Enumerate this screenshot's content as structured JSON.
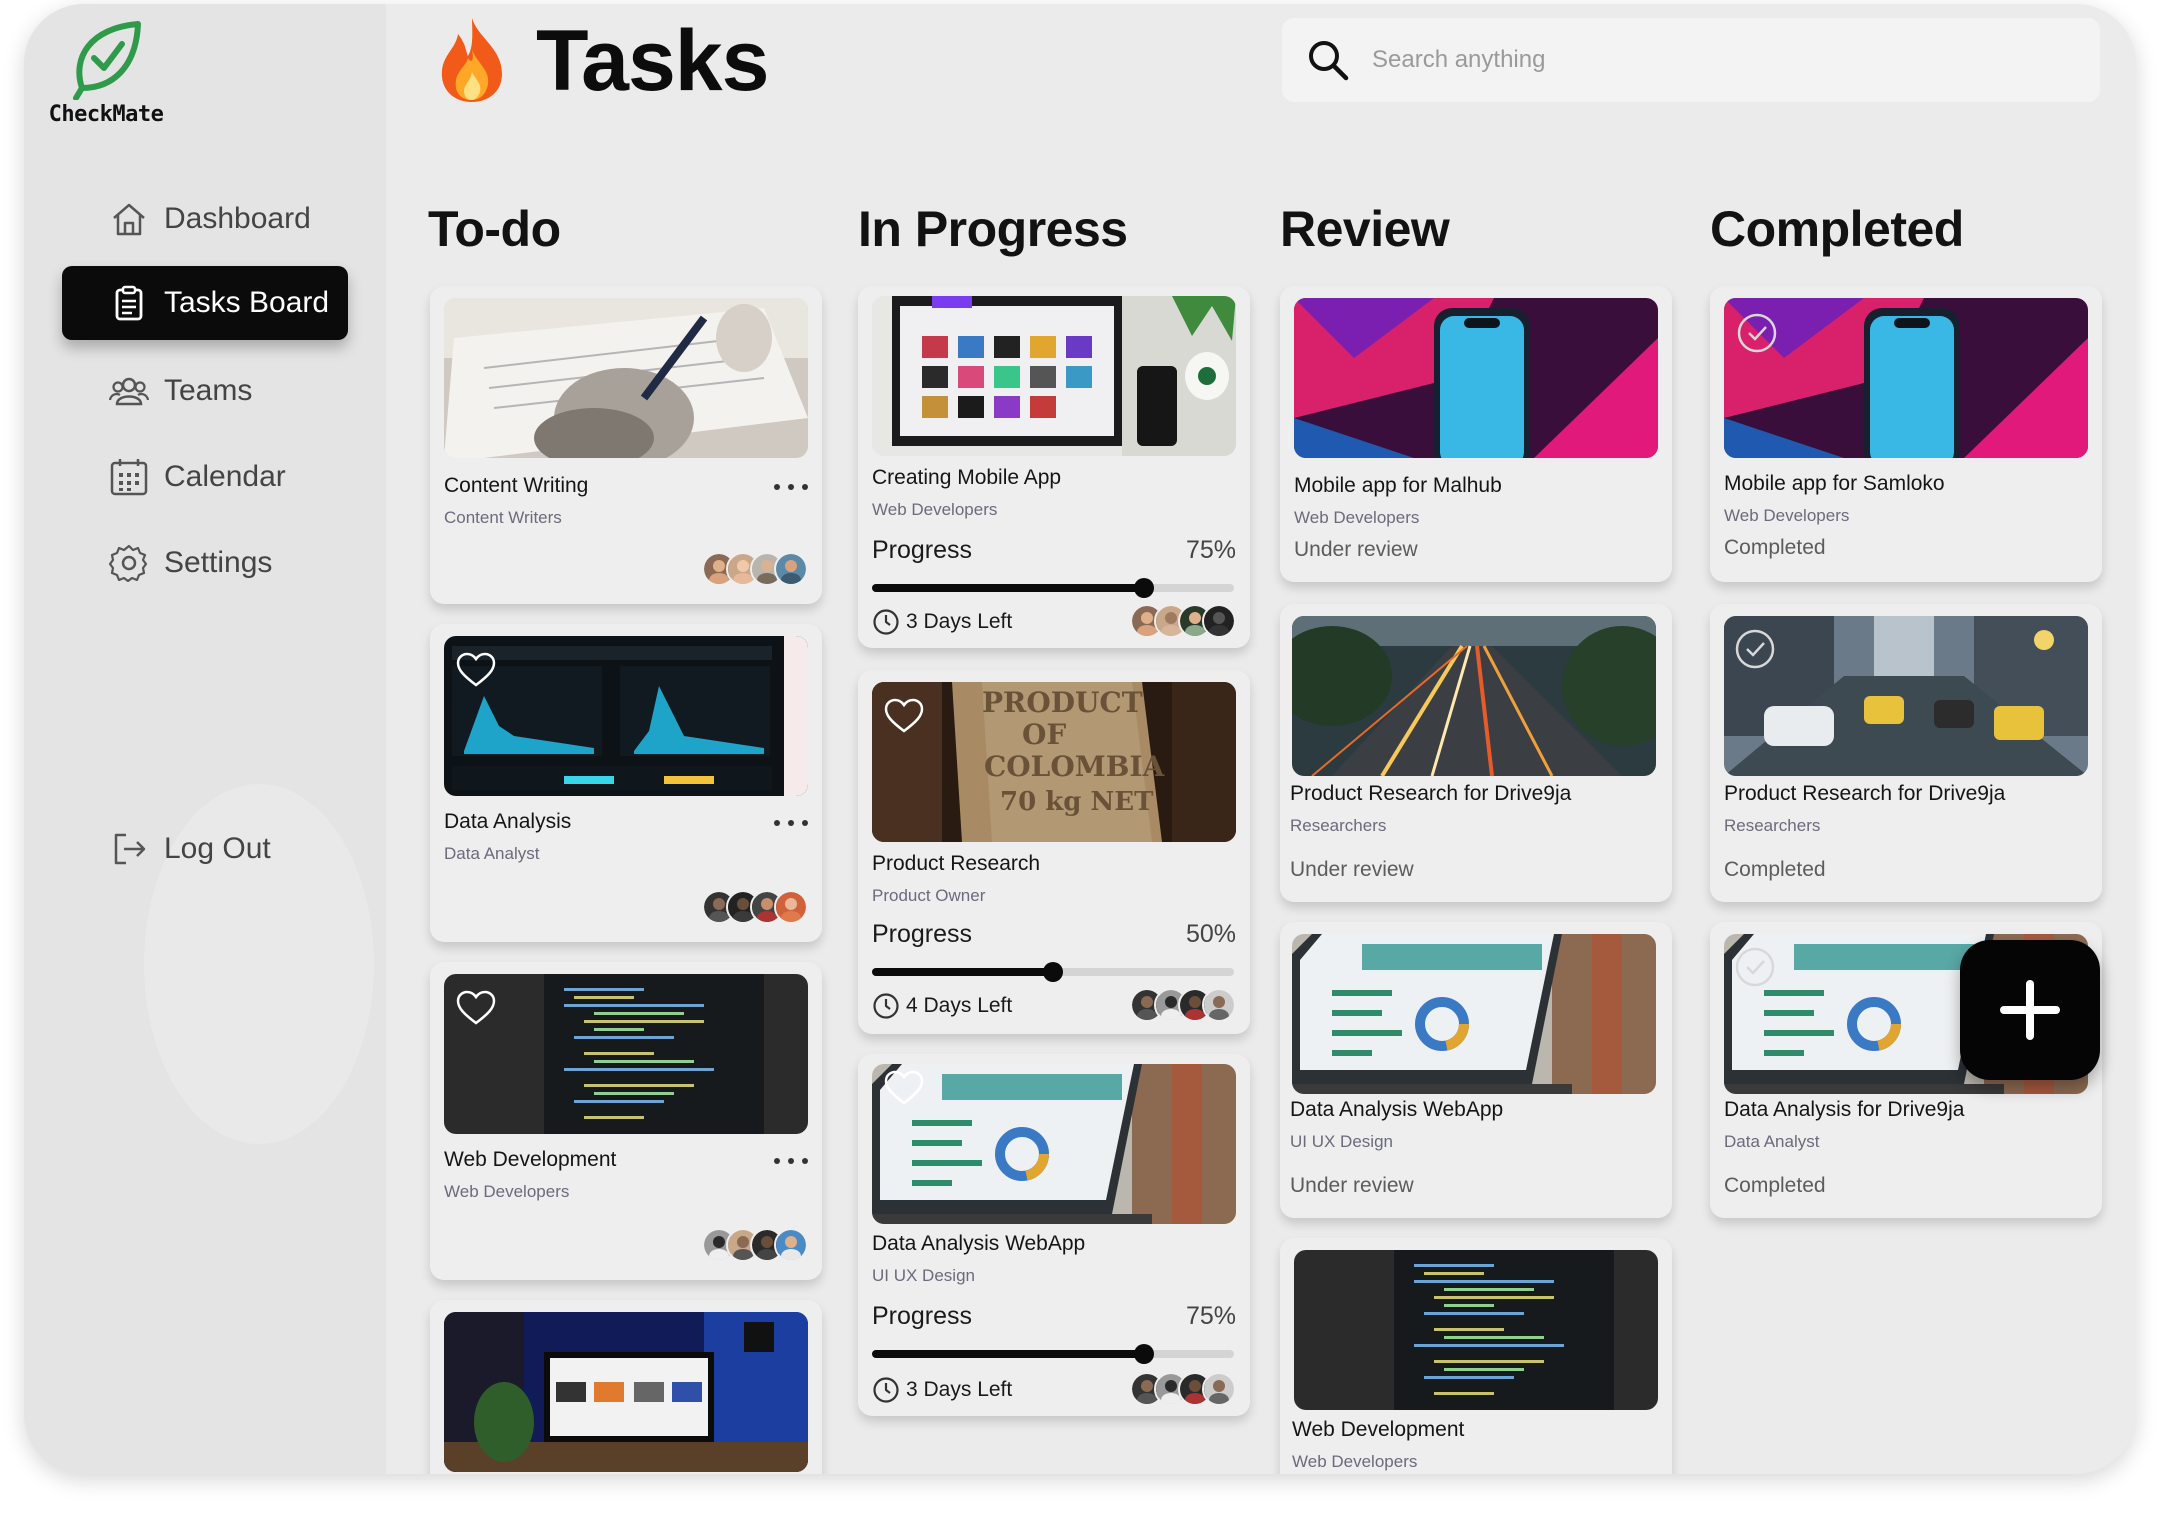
{
  "app": {
    "name": "CheckMate"
  },
  "sidebar": {
    "items": [
      {
        "label": "Dashboard",
        "icon": "home-icon"
      },
      {
        "label": "Tasks Board",
        "icon": "clipboard-icon",
        "active": true
      },
      {
        "label": "Teams",
        "icon": "users-icon"
      },
      {
        "label": "Calendar",
        "icon": "calendar-icon"
      },
      {
        "label": "Settings",
        "icon": "gear-icon"
      }
    ],
    "logout": {
      "label": "Log Out",
      "icon": "logout-icon"
    }
  },
  "header": {
    "emoji": "fire-icon",
    "title": "Tasks"
  },
  "search": {
    "placeholder": "Search anything",
    "value": ""
  },
  "columns": [
    {
      "title": "To-do",
      "cards": [
        {
          "title": "Content Writing",
          "team": "Content Writers",
          "image": "writing-photo"
        },
        {
          "title": "Data Analysis",
          "team": "Data Analyst",
          "image": "dashboard-photo"
        },
        {
          "title": "Web Development",
          "team": "Web Developers",
          "image": "code-photo"
        },
        {
          "title": "",
          "team": "",
          "image": "desk-monitor-photo"
        }
      ]
    },
    {
      "title": "In Progress",
      "cards": [
        {
          "title": "Creating Mobile App",
          "team": "Web Developers",
          "progress_label": "Progress",
          "progress_text": "75%",
          "progress": 0.75,
          "days_left": "3 Days Left",
          "image": "laptop-desk-photo"
        },
        {
          "title": "Product Research",
          "team": "Product Owner",
          "progress_label": "Progress",
          "progress_text": "50%",
          "progress": 0.5,
          "days_left": "4 Days Left",
          "image": "coffee-sack-photo"
        },
        {
          "title": "Data Analysis  WebApp",
          "team": "UI UX Design",
          "progress_label": "Progress",
          "progress_text": "75%",
          "progress": 0.75,
          "days_left": "3 Days Left",
          "image": "laptop-analytics-photo"
        }
      ]
    },
    {
      "title": "Review",
      "cards": [
        {
          "title": "Mobile app for Malhub",
          "team": "Web Developers",
          "status": "Under review",
          "image": "phone-neon-photo"
        },
        {
          "title": "Product Research for Drive9ja",
          "team": "Researchers",
          "status": "Under review",
          "image": "highway-photo"
        },
        {
          "title": "Data Analysis  WebApp",
          "team": "UI UX Design",
          "status": "Under review",
          "image": "laptop-analytics-photo"
        },
        {
          "title": "Web Development",
          "team": "Web Developers",
          "status": "",
          "image": "code-photo"
        }
      ]
    },
    {
      "title": "Completed",
      "cards": [
        {
          "title": "Mobile app for Samloko",
          "team": "Web Developers",
          "status": "Completed",
          "image": "phone-neon-photo"
        },
        {
          "title": "Product Research for Drive9ja",
          "team": "Researchers",
          "status": "Completed",
          "image": "city-street-photo"
        },
        {
          "title": "Data Analysis  for Drive9ja",
          "team": "Data Analyst",
          "status": "Completed",
          "image": "laptop-analytics-photo"
        }
      ]
    }
  ],
  "fab": {
    "icon": "plus-icon"
  },
  "colors": {
    "accent": "#0b0b0b",
    "brand_green": "#2f9a4a",
    "muted_text": "#6b6b7c"
  }
}
